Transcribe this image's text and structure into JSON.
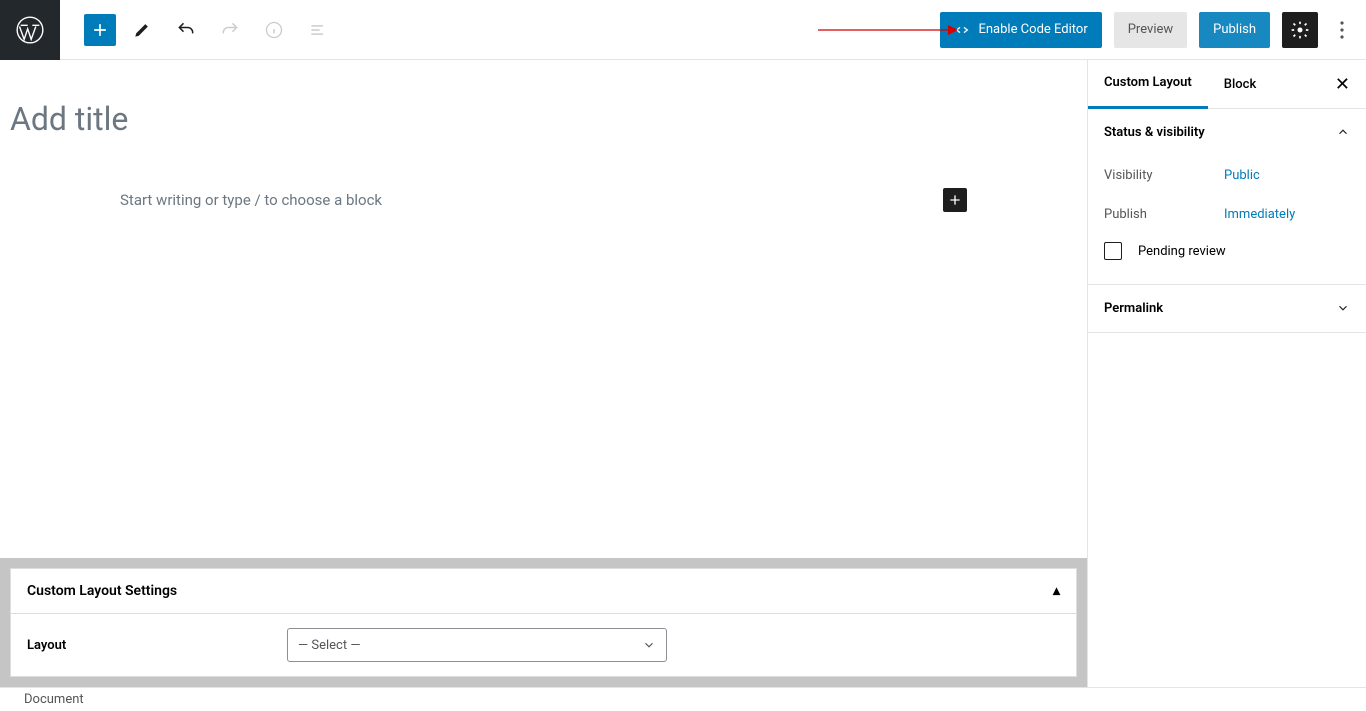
{
  "toolbar": {
    "code_editor_label": "Enable Code Editor",
    "preview_label": "Preview",
    "publish_label": "Publish"
  },
  "editor": {
    "title_placeholder": "Add title",
    "block_placeholder": "Start writing or type / to choose a block"
  },
  "settings_panel": {
    "title": "Custom Layout Settings",
    "layout_label": "Layout",
    "select_placeholder": "— Select —"
  },
  "breadcrumb": "Document",
  "sidebar": {
    "tabs": {
      "custom_layout": "Custom Layout",
      "block": "Block"
    },
    "sections": {
      "status": {
        "title": "Status & visibility",
        "visibility_label": "Visibility",
        "visibility_value": "Public",
        "publish_label": "Publish",
        "publish_value": "Immediately",
        "pending_label": "Pending review"
      },
      "permalink": {
        "title": "Permalink"
      }
    }
  }
}
